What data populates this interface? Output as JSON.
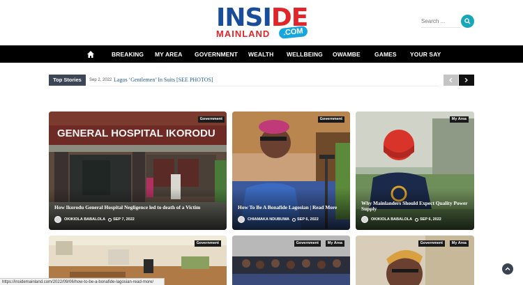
{
  "brand": {
    "inside_a": "INSI",
    "inside_b": "DE",
    "mainland": "MAINLAND",
    "com": ".COM"
  },
  "search": {
    "placeholder": "Search ..."
  },
  "nav": {
    "items": [
      "BREAKING",
      "MY AREA",
      "GOVERNMENT",
      "WEALTH",
      "WELLBEING",
      "OWAMBE",
      "GAMES",
      "YOUR SAY"
    ]
  },
  "ticker": {
    "label": "Top Stories",
    "date": "Sep 2, 2022",
    "title": "Lagos ‘Gentlemen’ In Suits [SEE PHOTOS]"
  },
  "cards": [
    {
      "category": "Government",
      "title": "How Ikorodu General Hospital Negligence led to death of a Victim",
      "author": "OKIKIOLA BABALOLA",
      "date": "SEP 7, 2022",
      "sign": "GENERAL HOSPITAL IKORODU"
    },
    {
      "category": "Government",
      "title": "How To Be A Bonafide Lagosian | Read More",
      "author": "CHIAMAKA NDUBUWA",
      "date": "SEP 6, 2022"
    },
    {
      "category": "My Area",
      "title": "Why Mainlanders Should Expect Quality Power Supply",
      "author": "OKIKIOLA BABALOLA",
      "date": "SEP 6, 2022"
    },
    {
      "category": "Government"
    },
    {
      "category": "Government",
      "category2": "My Area"
    },
    {
      "category": "Government",
      "category2": "My Area"
    }
  ],
  "status_bar": {
    "url": "https://insidemainland.com/2022/09/06/how-to-be-a-bonafide-lagosian-read-more/"
  },
  "colors": {
    "nav_bg": "#000000",
    "accent": "#17a6ba",
    "ticker_label_bg": "#3c4656",
    "brand_blue": "#1a4d99",
    "brand_red": "#e0262b"
  }
}
